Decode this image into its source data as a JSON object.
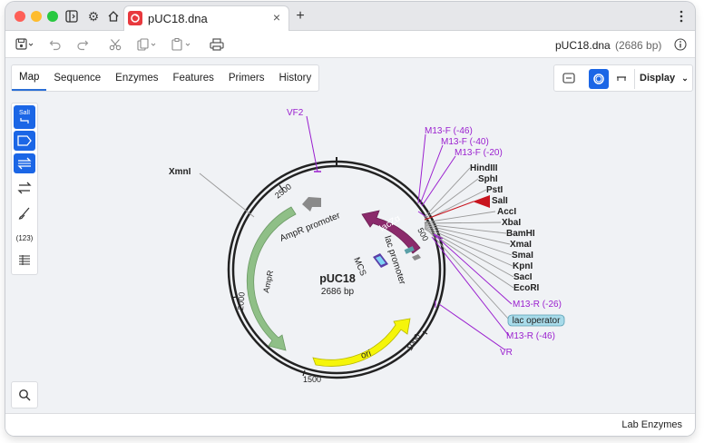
{
  "titlebar": {
    "tab_title": "pUC18.dna",
    "new_tab": "+"
  },
  "toolbar": {
    "filename": "pUC18.dna",
    "filesize": "(2686 bp)"
  },
  "view_tabs": [
    "Map",
    "Sequence",
    "Enzymes",
    "Features",
    "Primers",
    "History"
  ],
  "view_controls": {
    "display_label": "Display"
  },
  "left_tools": {
    "sali_label": "SalI",
    "count_label": "(123)"
  },
  "map": {
    "name": "pUC18",
    "length": "2686 bp",
    "ticks": [
      "2500",
      "2000",
      "1500",
      "1000",
      "500"
    ],
    "features": {
      "ampr_promoter": "AmpR promoter",
      "ampr": "AmpR",
      "ori": "ori",
      "lacz": "lacZα",
      "lac_promoter": "lac promoter",
      "mcs": "MCS",
      "lac_operator": "lac operator"
    },
    "enzymes": [
      "XmnI",
      "HindIII",
      "SphI",
      "PstI",
      "SalI",
      "AccI",
      "XbaI",
      "BamHI",
      "XmaI",
      "SmaI",
      "KpnI",
      "SacI",
      "EcoRI"
    ],
    "primers": [
      "VF2",
      "M13-F (-46)",
      "M13-F (-40)",
      "M13-F (-20)",
      "M13-R (-26)",
      "M13-R (-46)",
      "VR"
    ]
  },
  "status": {
    "text": "Lab Enzymes"
  },
  "colors": {
    "ampr": "#8fbf87",
    "ori": "#f5f50a",
    "lacz": "#8b2a6b",
    "primer": "#9a1fcf",
    "accent": "#1b66e6",
    "sali": "#c8141e"
  }
}
